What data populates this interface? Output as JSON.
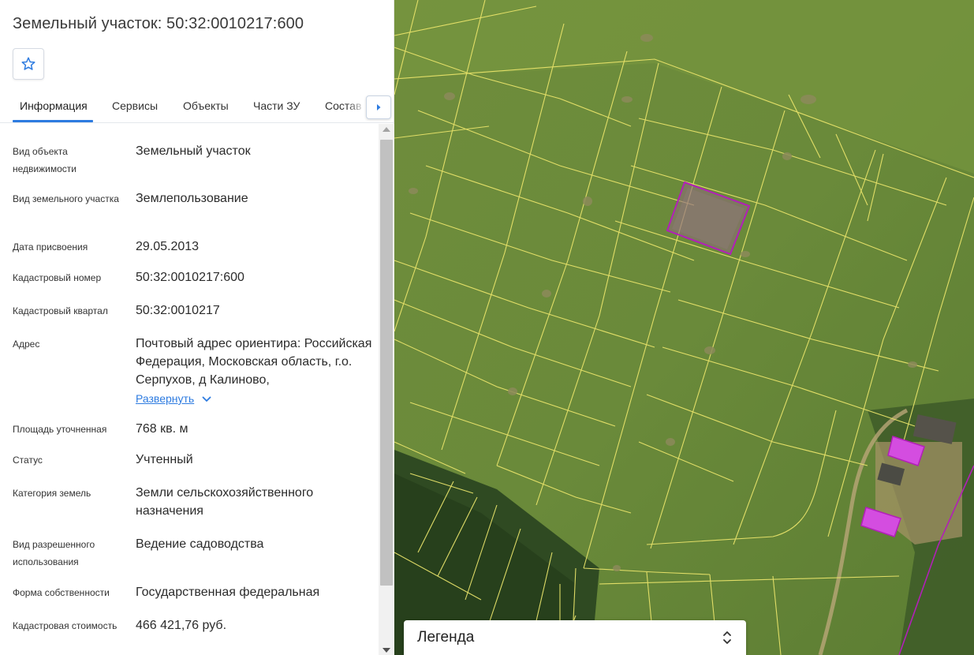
{
  "panel": {
    "title": "Земельный участок: 50:32:0010217:600",
    "tabs": [
      {
        "label": "Информация"
      },
      {
        "label": "Сервисы"
      },
      {
        "label": "Объекты"
      },
      {
        "label": "Части ЗУ"
      },
      {
        "label": "Состав"
      }
    ],
    "fields": [
      {
        "label": "Вид объекта недвижимости",
        "value": "Земельный участок"
      },
      {
        "label": "Вид земельного участка",
        "value": "Землепользование"
      },
      {
        "label": "Дата присвоения",
        "value": "29.05.2013"
      },
      {
        "label": "Кадастровый номер",
        "value": "50:32:0010217:600"
      },
      {
        "label": "Кадастровый квартал",
        "value": "50:32:0010217"
      },
      {
        "label": "Адрес",
        "value": "Почтовый адрес ориентира: Российская Федерация, Московская область, г.о. Серпухов, д Калиново,"
      },
      {
        "label": "Площадь уточненная",
        "value": "768 кв. м"
      },
      {
        "label": "Статус",
        "value": "Учтенный"
      },
      {
        "label": "Категория земель",
        "value": "Земли сельскохозяйственного назначения"
      },
      {
        "label": "Вид разрешенного использования",
        "value": "Ведение садоводства"
      },
      {
        "label": "Форма собственности",
        "value": "Государственная федеральная"
      },
      {
        "label": "Кадастровая стоимость",
        "value": "466 421,76 руб."
      }
    ],
    "expand_label": "Развернуть"
  },
  "map": {
    "legend_title": "Легенда"
  },
  "colors": {
    "accent": "#2d7be0",
    "parcel_lines": "#e8e36a",
    "selected_parcel": "#b21fb8",
    "buildings": "#d44de0"
  },
  "icons": {
    "favorite": "star-icon",
    "tabs_scroll": "caret-right-icon",
    "expand": "chevron-down-icon",
    "legend_toggle": "chevrons-up-down-icon"
  }
}
